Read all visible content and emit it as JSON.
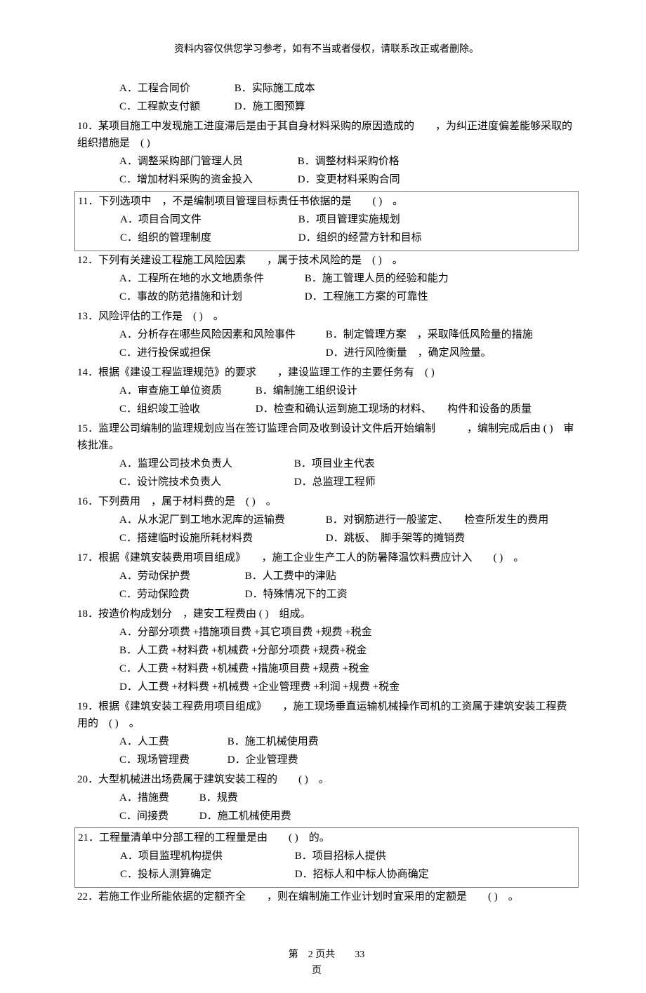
{
  "header_notice": "资料内容仅供您学习参考，如有不当或者侵权，请联系改正或者删除。",
  "q9_opts": {
    "a": "A．工程合同价",
    "b": "B．实际施工成本",
    "c": "C．工程款支付额",
    "d": "D．施工图预算"
  },
  "q10": {
    "stem": "10．某项目施工中发现施工进度滞后是由于其自身材料采购的原因造成的　　，为纠正进度偏差能够采取的组织措施是　( )",
    "a": "A．调整采购部门管理人员",
    "b": "B．调整材料采购价格",
    "c": "C．增加材料采购的资金投入",
    "d": "D．变更材料采购合同"
  },
  "q11": {
    "stem": "11．下列选项中　，不是编制项目管理目标责任书依据的是　　( )　。",
    "a": "A．项目合同文件",
    "b": "B．项目管理实施规划",
    "c": "C．组织的管理制度",
    "d": "D．组织的经营方针和目标"
  },
  "q12": {
    "stem": "12．下列有关建设工程施工风险因素　　，属于技术风险的是　( )　。",
    "a": "A．工程所在地的水文地质条件",
    "b": "B．施工管理人员的经验和能力",
    "c": "C．事故的防范措施和计划",
    "d": "D．工程施工方案的可靠性"
  },
  "q13": {
    "stem": "13．风险评估的工作是　( )　。",
    "a": "A．分析存在哪些风险因素和风险事件",
    "b": "B．制定管理方案　，采取降低风险量的措施",
    "c": "C．进行投保或担保",
    "d": "D．进行风险衡量　，确定风险量。"
  },
  "q14": {
    "stem": "14．根据《建设工程监理规范》的要求　　，建设监理工作的主要任务有　( )",
    "a": "A．审查施工单位资质",
    "b": "B．编制施工组织设计",
    "c": "C．组织竣工验收",
    "d": "D．检查和确认运到施工现场的材料、　　构件和设备的质量"
  },
  "q15": {
    "stem": "15．监理公司编制的监理规划应当在签订监理合同及收到设计文件后开始编制　　　，编制完成后由 ( )　审核批准。",
    "a": "A．监理公司技术负责人",
    "b": "B．项目业主代表",
    "c": "C．设计院技术负责人",
    "d": "D．总监理工程师"
  },
  "q16": {
    "stem": "16．下列费用　，属于材料费的是　( )　。",
    "a": "A．从水泥厂到工地水泥库的运输费",
    "b": "B．对钢筋进行一般鉴定、　　检查所发生的费用",
    "c": "C．搭建临时设施所耗材料费",
    "d": "D．跳板、　脚手架等的摊销费"
  },
  "q17": {
    "stem": "17．根据《建筑安装费用项目组成》　　，施工企业生产工人的防暑降温饮料费应计入　　( )　。",
    "a": "A．劳动保护费",
    "b": "B．人工费中的津贴",
    "c": "C．劳动保险费",
    "d": "D．特殊情况下的工资"
  },
  "q18": {
    "stem": "18．按造价构成划分　，建安工程费由 ( )　组成。",
    "a": "A．分部分项费  +措施项目费  +其它项目费  +规费 +税金",
    "b": "B．人工费 +材料费 +机械费 +分部分项费  +规费+税金",
    "c": "C．人工费 +材料费 +机械费 +措施项目费  +规费 +税金",
    "d": "D．人工费 +材料费 +机械费 +企业管理费  +利润 +规费 +税金"
  },
  "q19": {
    "stem": "19．根据《建筑安装工程费用项目组成》　　，施工现场垂直运输机械操作司机的工资属于建筑安装工程费用的　( )　。",
    "a": "A．人工费",
    "b": "B．施工机械使用费",
    "c": "C．现场管理费",
    "d": "D．企业管理费"
  },
  "q20": {
    "stem": "20．大型机械进出场费属于建筑安装工程的　　( )　。",
    "a": "A．措施费",
    "b": "B．规费",
    "c": "C．间接费",
    "d": "D．施工机械使用费"
  },
  "q21": {
    "stem": "21．工程量清单中分部工程的工程量是由　　( )　的。",
    "a": "A．项目监理机构提供",
    "b": "B．项目招标人提供",
    "c": "C．投标人测算确定",
    "d": "D．招标人和中标人协商确定"
  },
  "q22": {
    "stem": "22．若施工作业所能依据的定额齐全　　，则在编制施工作业计划时宜采用的定额是　　( )　。"
  },
  "footer": {
    "line1_a": "第",
    "line1_b": "2 页共",
    "line1_c": "33",
    "line2": "页"
  }
}
